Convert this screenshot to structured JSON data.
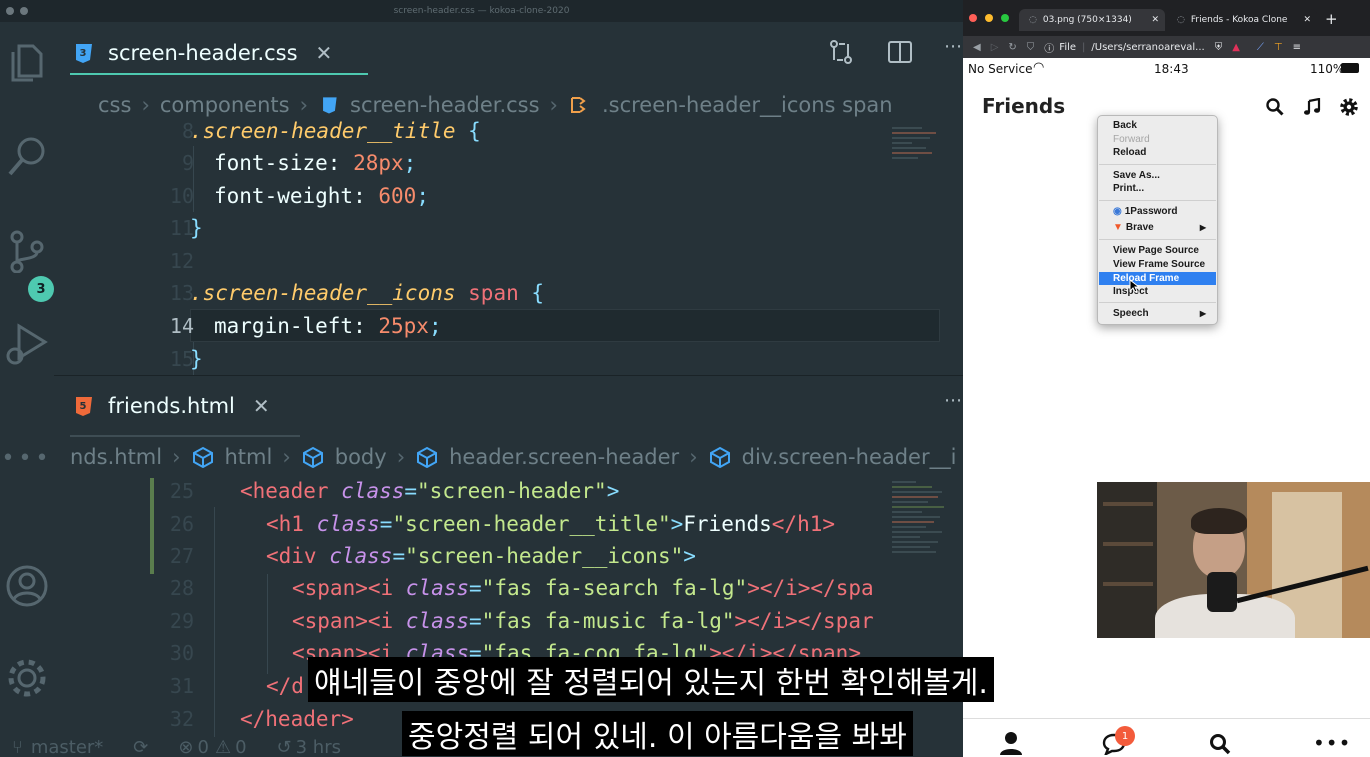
{
  "window_title": "screen-header.css — kokoa-clone-2020",
  "editor": {
    "scm_badge": "3",
    "top_tab": {
      "name": "screen-header.css",
      "close": "✕"
    },
    "top_breadcrumb": [
      "css",
      "components",
      "screen-header.css",
      ".screen-header__icons span"
    ],
    "top_lines": [
      {
        "n": "8"
      },
      {
        "n": "9"
      },
      {
        "n": "10"
      },
      {
        "n": "11"
      },
      {
        "n": "12"
      },
      {
        "n": "13"
      },
      {
        "n": "14"
      },
      {
        "n": "15"
      }
    ],
    "top_code": {
      "l8_sel": ".screen-header__title",
      "l8_brace": " {",
      "l9_prop": "font-size: ",
      "l9_val": "28px",
      "l9_end": ";",
      "l10_prop": "font-weight: ",
      "l10_val": "600",
      "l10_end": ";",
      "l11": "}",
      "l13_sel": ".screen-header__icons",
      "l13_tag": " span",
      "l13_brace": " {",
      "l14_prop": "margin-left: ",
      "l14_val": "25px",
      "l14_end": ";",
      "l15": "}"
    },
    "bottom_tab": {
      "name": "friends.html",
      "close": "✕"
    },
    "bottom_breadcrumb": [
      "nds.html",
      "html",
      "body",
      "header.screen-header",
      "div.screen-header__i"
    ],
    "bottom_lines": [
      {
        "n": "25"
      },
      {
        "n": "26"
      },
      {
        "n": "27"
      },
      {
        "n": "28"
      },
      {
        "n": "29"
      },
      {
        "n": "30"
      },
      {
        "n": "31"
      },
      {
        "n": "32"
      }
    ],
    "bottom_code": {
      "l25_a": "<header ",
      "l25_attr": "class",
      "l25_eq": "=",
      "l25_str": "\"screen-header\"",
      "l25_end": ">",
      "l26_a": "<h1 ",
      "l26_attr": "class",
      "l26_eq": "=",
      "l26_str": "\"screen-header__title\"",
      "l26_mid": ">",
      "l26_txt": "Friends",
      "l26_end": "</h1>",
      "l27_a": "<div ",
      "l27_attr": "class",
      "l27_eq": "=",
      "l27_str": "\"screen-header__icons\"",
      "l27_end": ">",
      "l28_a": "<span><i ",
      "l28_attr": "class",
      "l28_eq": "=",
      "l28_str": "\"fas fa-search fa-lg\"",
      "l28_end": "></i></spa",
      "l29_a": "<span><i ",
      "l29_attr": "class",
      "l29_eq": "=",
      "l29_str": "\"fas fa-music fa-lg\"",
      "l29_end": "></i></spar",
      "l30_a": "<span><i ",
      "l30_attr": "class",
      "l30_eq": "=",
      "l30_str": "\"fas fa-cog fa-lg\"",
      "l30_end": "></i></span>",
      "l31": "</d",
      "l32": "</header>"
    },
    "status": {
      "branch": "master*",
      "errors": "0",
      "warnings": "0",
      "time": "3 hrs"
    }
  },
  "browser": {
    "tabs": [
      "03.png (750×1334)",
      "Friends - Kokoa Clone"
    ],
    "address_prefix": "File",
    "address": "/Users/serranoareval...",
    "phone_status": {
      "carrier": "No Service",
      "time": "18:43",
      "battery": "110%"
    },
    "app_title": "Friends",
    "chat_badge": "1",
    "context_menu": {
      "back": "Back",
      "forward": "Forward",
      "reload": "Reload",
      "save_as": "Save As...",
      "print": "Print...",
      "onepassword": "1Password",
      "brave": "Brave",
      "view_page_source": "View Page Source",
      "view_frame_source": "View Frame Source",
      "reload_frame": "Reload Frame",
      "inspect": "Inspect",
      "speech": "Speech"
    }
  },
  "subtitles": {
    "line1": "얘네들이 중앙에 잘 정렬되어 있는지 한번 확인해볼게.",
    "line2": "중앙정렬 되어 있네. 이 아름다움을 봐봐"
  },
  "colors": {
    "accent": "#4ec9b0",
    "selector": "#ffcb6b",
    "tag": "#f07178",
    "number": "#f78c6c",
    "string": "#c3e88d",
    "attribute": "#c792ea",
    "menu_highlight": "#2f80f0",
    "badge": "#f35b3b"
  }
}
